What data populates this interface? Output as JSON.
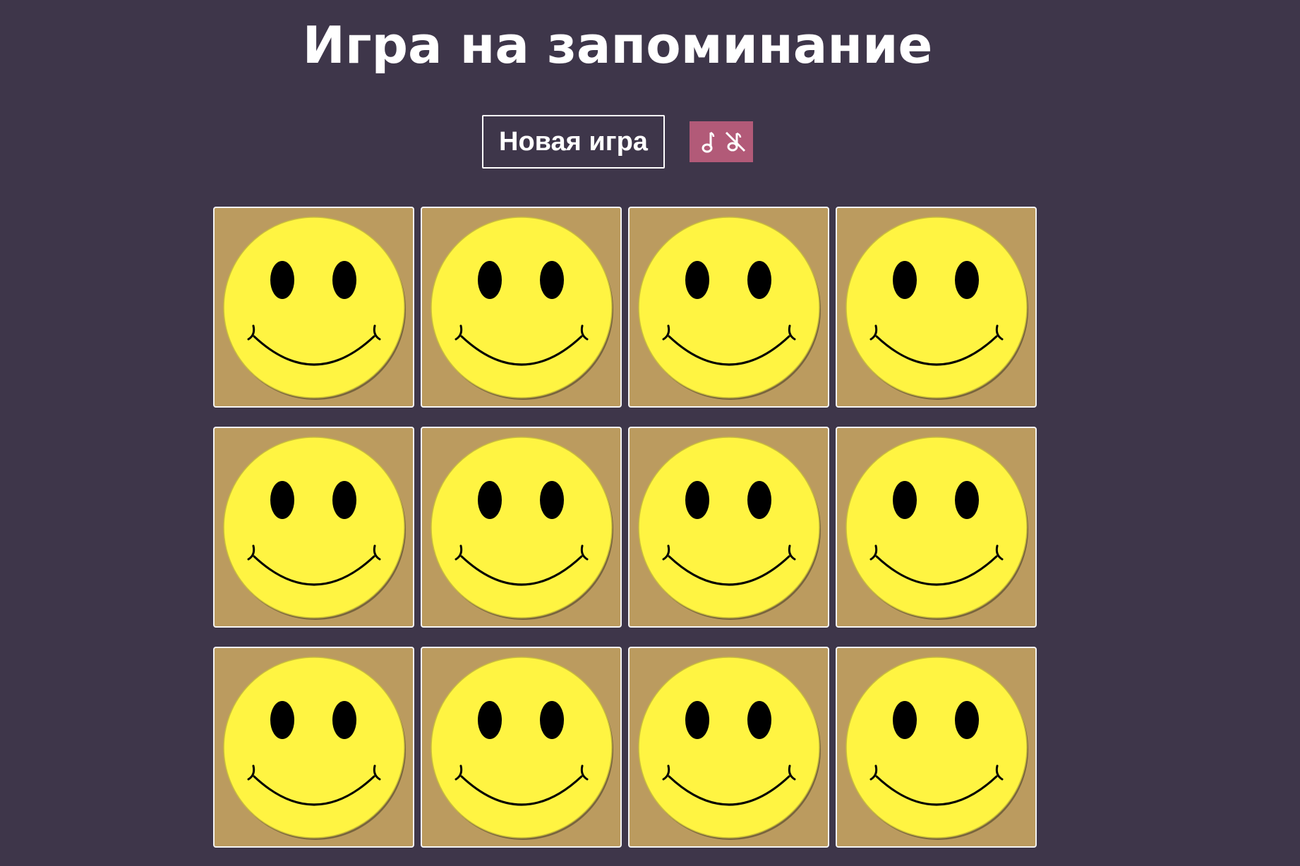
{
  "header": {
    "title": "Игра на запоминание"
  },
  "controls": {
    "new_game_label": "Новая игра",
    "sound_on_icon": "music-note-icon",
    "sound_off_icon": "music-off-icon"
  },
  "colors": {
    "background": "#3e364a",
    "card_back": "#bb9b5f",
    "card_border": "#f4f4f4",
    "smiley_yellow": "#fff442",
    "sound_box": "#b25a78"
  },
  "board": {
    "rows": 3,
    "columns": 4,
    "cards": [
      {
        "face": "smiley-icon",
        "state": "face-down"
      },
      {
        "face": "smiley-icon",
        "state": "face-down"
      },
      {
        "face": "smiley-icon",
        "state": "face-down"
      },
      {
        "face": "smiley-icon",
        "state": "face-down"
      },
      {
        "face": "smiley-icon",
        "state": "face-down"
      },
      {
        "face": "smiley-icon",
        "state": "face-down"
      },
      {
        "face": "smiley-icon",
        "state": "face-down"
      },
      {
        "face": "smiley-icon",
        "state": "face-down"
      },
      {
        "face": "smiley-icon",
        "state": "face-down"
      },
      {
        "face": "smiley-icon",
        "state": "face-down"
      },
      {
        "face": "smiley-icon",
        "state": "face-down"
      },
      {
        "face": "smiley-icon",
        "state": "face-down"
      }
    ]
  }
}
